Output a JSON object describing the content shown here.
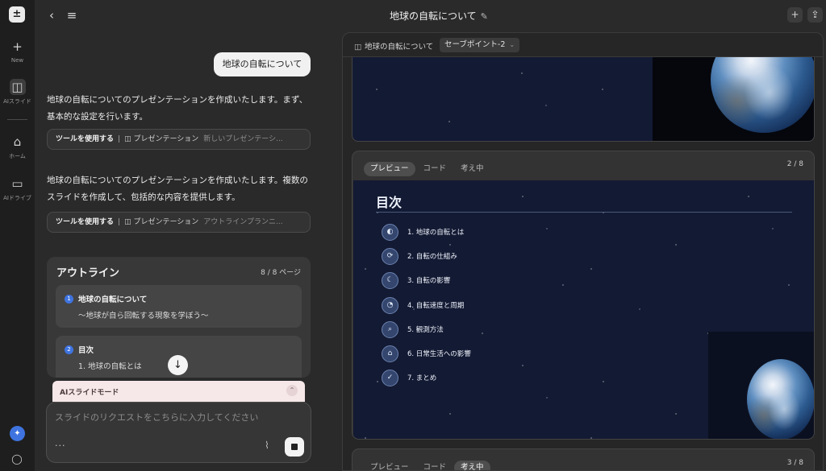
{
  "rail": {
    "new_label": "New",
    "ai_slides_label": "AIスライド",
    "home_label": "ホーム",
    "ai_drive_label": "AIドライブ"
  },
  "header": {
    "title": "地球の自転について",
    "back_icon": "chevron-left-icon",
    "menu_icon": "menu-icon",
    "edit_icon": "pencil-icon",
    "add_icon": "plus-icon",
    "share_icon": "share-icon"
  },
  "chat": {
    "user_message": "地球の自転について",
    "ai_message_1": "地球の自転についてのプレゼンテーションを作成いたします。まず、基本的な設定を行います。",
    "tool_1": {
      "label": "ツールを使用する",
      "name": "プレゼンテーション",
      "detail": "新しいプレゼンテーシ..."
    },
    "ai_message_2": "地球の自転についてのプレゼンテーションを作成いたします。複数のスライドを作成して、包括的な内容を提供します。",
    "tool_2": {
      "label": "ツールを使用する",
      "name": "プレゼンテーション",
      "detail": "アウトラインプランニ..."
    }
  },
  "outline": {
    "title": "アウトライン",
    "count": "8 / 8 ページ",
    "items": [
      {
        "num": "1",
        "heading": "地球の自転について",
        "sub": "～地球が自ら回転する現象を学ぼう～"
      },
      {
        "num": "2",
        "heading": "目次",
        "sub": "1. 地球の自転とは"
      }
    ]
  },
  "mode_bar": {
    "label": "AIスライドモード"
  },
  "input": {
    "placeholder": "スライドのリクエストをこちらに入力してください",
    "more_label": "···"
  },
  "preview": {
    "file_name": "地球の自転について",
    "savepoint": "セーブポイント-2",
    "slide2": {
      "tabs": [
        "プレビュー",
        "コード",
        "考え中"
      ],
      "active_tab": "プレビュー",
      "page": "2 / 8",
      "title": "目次",
      "items": [
        {
          "icon": "globe-icon",
          "glyph": "◐",
          "text": "1. 地球の自転とは"
        },
        {
          "icon": "rotate-icon",
          "glyph": "⟳",
          "text": "2. 自転の仕組み"
        },
        {
          "icon": "moon-icon",
          "glyph": "☾",
          "text": "3. 自転の影響"
        },
        {
          "icon": "gauge-icon",
          "glyph": "◔",
          "text": "4. 自転速度と周期"
        },
        {
          "icon": "search-icon",
          "glyph": "⌕",
          "text": "5. 観測方法"
        },
        {
          "icon": "home-icon",
          "glyph": "⌂",
          "text": "6. 日常生活への影響"
        },
        {
          "icon": "check-icon",
          "glyph": "✓",
          "text": "7. まとめ"
        }
      ]
    },
    "slide3": {
      "tabs": [
        "プレビュー",
        "コード",
        "考え中"
      ],
      "active_tab": "考え中",
      "page": "3 / 8"
    }
  },
  "colors": {
    "accent": "#3f74e0",
    "slide_bg": "#131a33",
    "mode_bar": "#f6e7e8"
  }
}
